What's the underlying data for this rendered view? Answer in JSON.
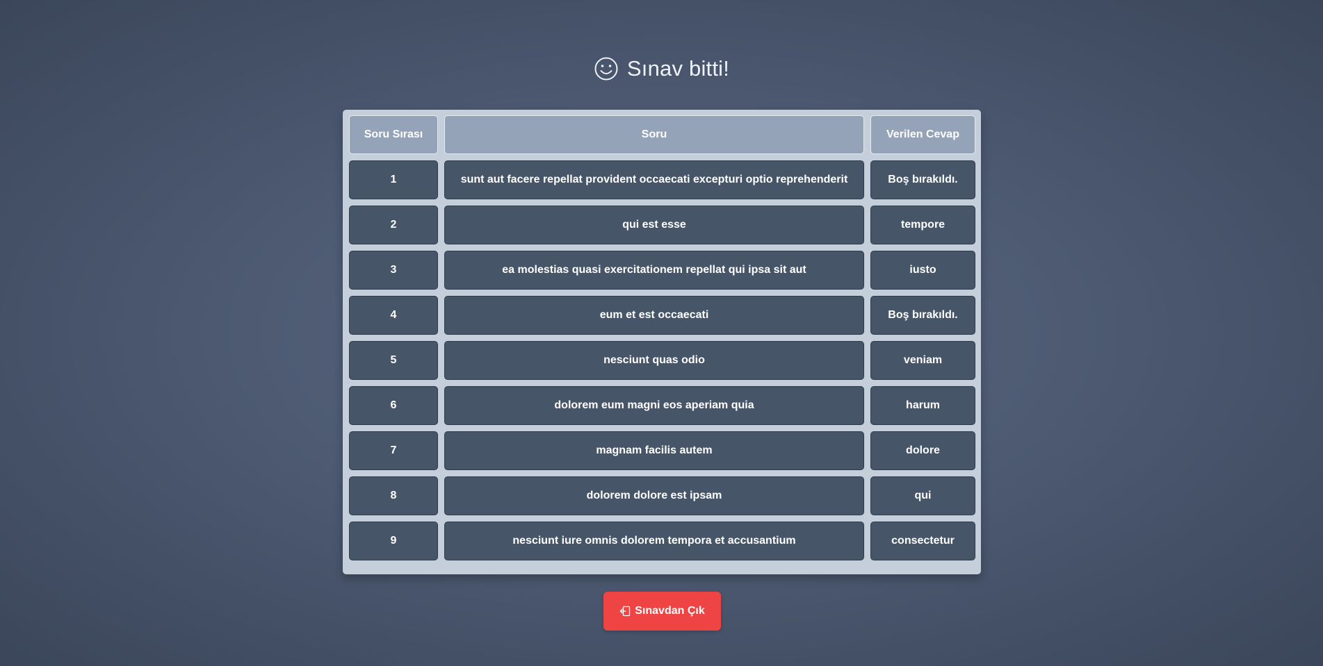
{
  "header": {
    "icon": "smile-icon",
    "title": "Sınav bitti!"
  },
  "table": {
    "columns": [
      "Soru Sırası",
      "Soru",
      "Verilen Cevap"
    ],
    "rows": [
      [
        "1",
        "sunt aut facere repellat provident occaecati excepturi optio reprehenderit",
        "Boş bırakıldı."
      ],
      [
        "2",
        "qui est esse",
        "tempore"
      ],
      [
        "3",
        "ea molestias quasi exercitationem repellat qui ipsa sit aut",
        "iusto"
      ],
      [
        "4",
        "eum et est occaecati",
        "Boş bırakıldı."
      ],
      [
        "5",
        "nesciunt quas odio",
        "veniam"
      ],
      [
        "6",
        "dolorem eum magni eos aperiam quia",
        "harum"
      ],
      [
        "7",
        "magnam facilis autem",
        "dolore"
      ],
      [
        "8",
        "dolorem dolore est ipsam",
        "qui"
      ],
      [
        "9",
        "nesciunt iure omnis dolorem tempora et accusantium",
        "consectetur"
      ]
    ]
  },
  "exit_button": {
    "icon": "logout-icon",
    "label": "Sınavdan Çık",
    "color": "#ef4444"
  },
  "colors": {
    "header_cell": "#94a3b8",
    "body_cell": "#475569",
    "table_bg": "#c5cfdc"
  }
}
